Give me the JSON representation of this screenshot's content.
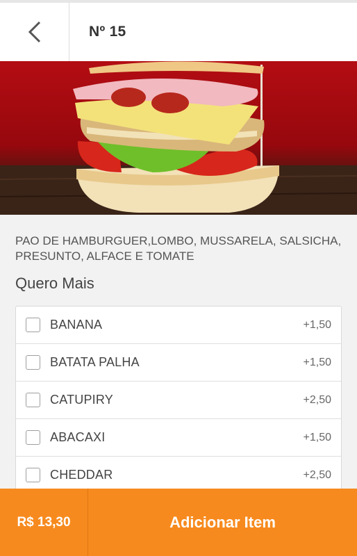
{
  "header": {
    "back_icon": "chevron-left-icon",
    "title": "Nº 15"
  },
  "product": {
    "image_icon": "hamburger-photo",
    "description": "PAO DE HAMBURGUER,LOMBO, MUSSARELA, SALSICHA, PRESUNTO, ALFACE E TOMATE"
  },
  "extras": {
    "title": "Quero Mais",
    "items": [
      {
        "label": "BANANA",
        "price": "+1,50",
        "checked": false
      },
      {
        "label": "BATATA PALHA",
        "price": "+1,50",
        "checked": false
      },
      {
        "label": "CATUPIRY",
        "price": "+2,50",
        "checked": false
      },
      {
        "label": "ABACAXI",
        "price": "+1,50",
        "checked": false
      },
      {
        "label": "CHEDDAR",
        "price": "+2,50",
        "checked": false
      }
    ]
  },
  "footer": {
    "total": "R$ 13,30",
    "add_label": "Adicionar Item"
  },
  "colors": {
    "accent": "#f78a1e",
    "hero_red": "#b30d13"
  }
}
